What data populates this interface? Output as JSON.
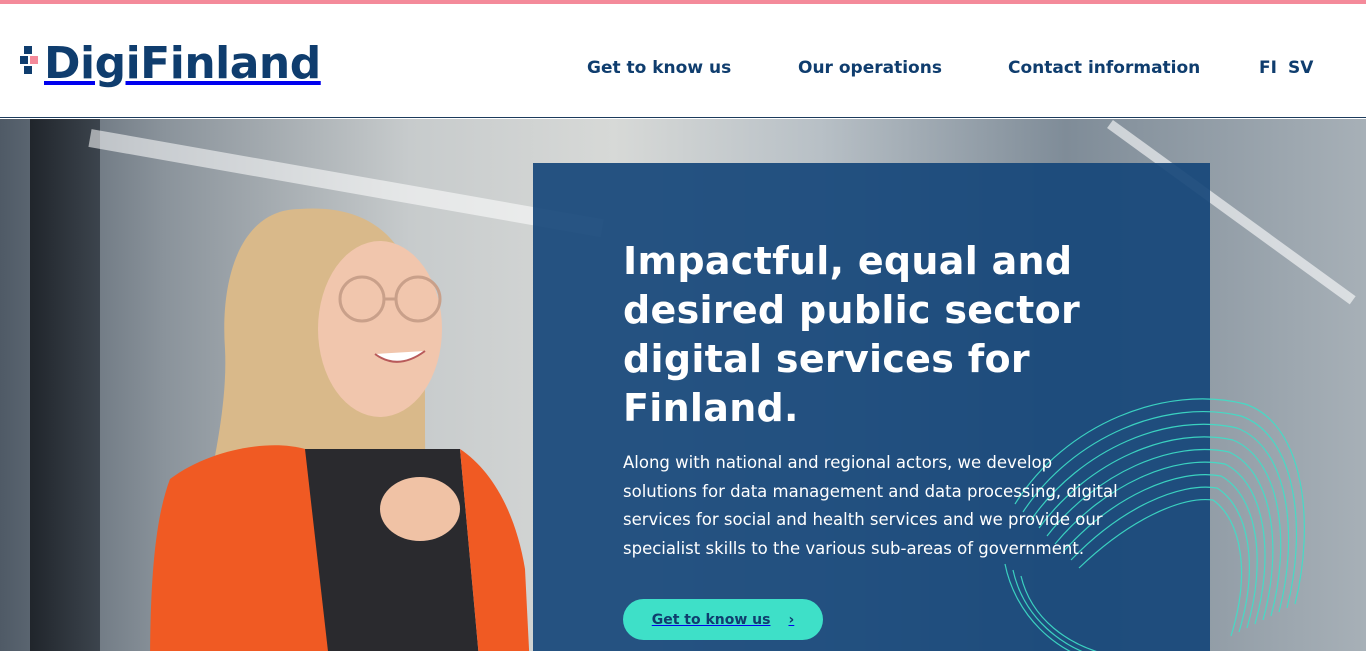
{
  "brand": {
    "name": "DigiFinland",
    "colors": {
      "accent_pink": "#f48a9a",
      "navy": "#0f3d6e",
      "teal": "#3ee0c8",
      "card_blue": "#16467a"
    }
  },
  "nav": {
    "items": [
      {
        "label": "Get to know us"
      },
      {
        "label": "Our operations"
      },
      {
        "label": "Contact information"
      }
    ],
    "languages": [
      "FI",
      "SV"
    ]
  },
  "hero": {
    "headline": "Impactful, equal and desired public sector digital services for Finland.",
    "lead": "Along with national and regional actors, we develop solutions for data management and data processing, digital services for social and health services and we provide our specialist skills to the various sub-areas of government.",
    "cta": {
      "label": "Get to know us",
      "icon": "chevron-right-icon",
      "glyph": "›"
    }
  }
}
